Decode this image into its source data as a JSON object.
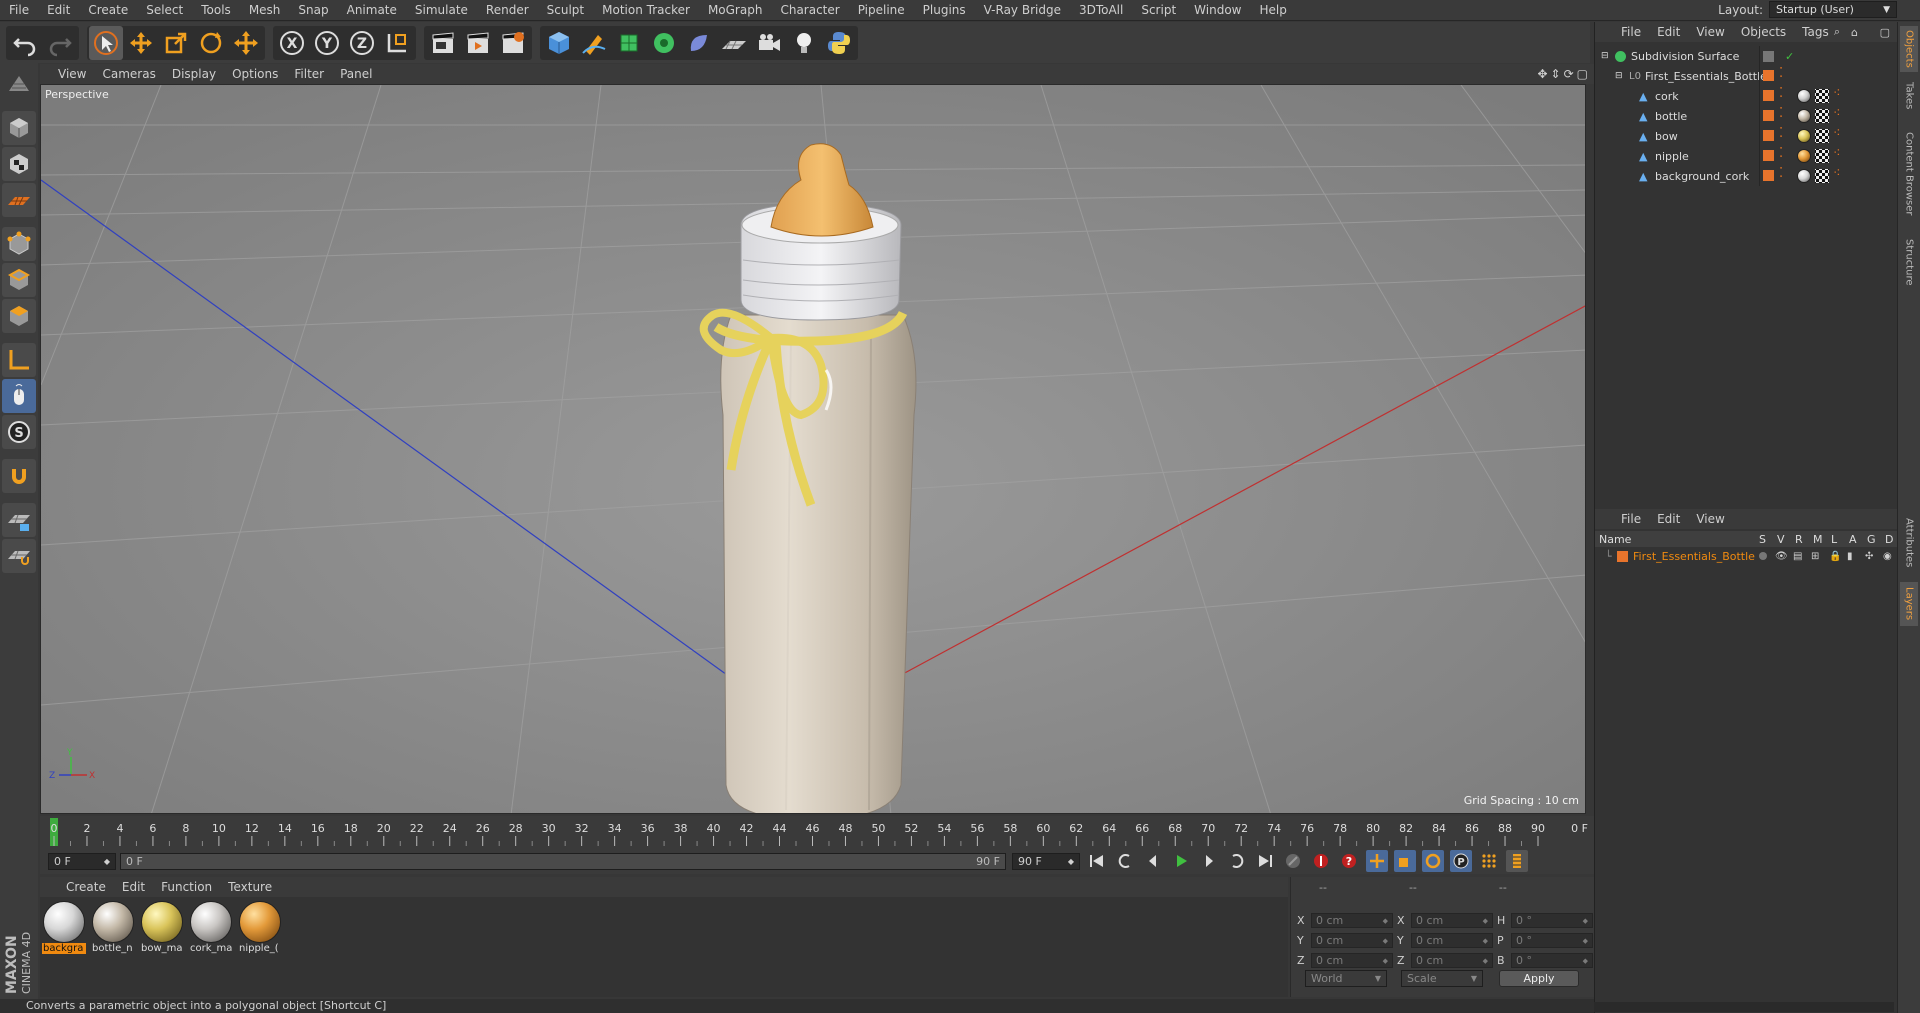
{
  "menu": [
    "File",
    "Edit",
    "Create",
    "Select",
    "Tools",
    "Mesh",
    "Snap",
    "Animate",
    "Simulate",
    "Render",
    "Sculpt",
    "Motion Tracker",
    "MoGraph",
    "Character",
    "Pipeline",
    "Plugins",
    "V-Ray Bridge",
    "3DToAll",
    "Script",
    "Window",
    "Help"
  ],
  "layout": {
    "label": "Layout:",
    "value": "Startup (User)"
  },
  "viewport": {
    "menu": [
      "View",
      "Cameras",
      "Display",
      "Options",
      "Filter",
      "Panel"
    ],
    "camera_label": "Perspective",
    "grid_spacing": "Grid Spacing : 10 cm"
  },
  "timeline": {
    "ticks": [
      "0",
      "2",
      "4",
      "6",
      "8",
      "10",
      "12",
      "14",
      "16",
      "18",
      "20",
      "22",
      "24",
      "26",
      "28",
      "30",
      "32",
      "34",
      "36",
      "38",
      "40",
      "42",
      "44",
      "46",
      "48",
      "50",
      "52",
      "54",
      "56",
      "58",
      "60",
      "62",
      "64",
      "66",
      "68",
      "70",
      "72",
      "74",
      "76",
      "78",
      "80",
      "82",
      "84",
      "86",
      "88",
      "90"
    ],
    "current_frame": "0 F",
    "right_frame": "0 F",
    "start_field": "0 F",
    "range_start": "0 F",
    "range_end": "90 F",
    "end_field": "90 F"
  },
  "materials": {
    "menu": [
      "Create",
      "Edit",
      "Function",
      "Texture"
    ],
    "items": [
      {
        "name": "backgra",
        "color": "#d7d7d7",
        "selected": true
      },
      {
        "name": "bottle_n",
        "color": "#c4b9a8",
        "selected": false
      },
      {
        "name": "bow_ma",
        "color": "#d9c45a",
        "selected": false
      },
      {
        "name": "cork_ma",
        "color": "#c9c6c3",
        "selected": false
      },
      {
        "name": "nipple_(",
        "color": "#e39a3a",
        "selected": false
      }
    ]
  },
  "coordinates": {
    "header": [
      "--",
      "--",
      "--"
    ],
    "rows": [
      {
        "a": "X",
        "av": "0 cm",
        "b": "X",
        "bv": "0 cm",
        "c": "H",
        "cv": "0 °"
      },
      {
        "a": "Y",
        "av": "0 cm",
        "b": "Y",
        "bv": "0 cm",
        "c": "P",
        "cv": "0 °"
      },
      {
        "a": "Z",
        "av": "0 cm",
        "b": "Z",
        "bv": "0 cm",
        "c": "B",
        "cv": "0 °"
      }
    ],
    "mode1": "World",
    "mode2": "Scale",
    "apply": "Apply"
  },
  "status": "Converts a parametric object into a polygonal object [Shortcut C]",
  "brand": {
    "maxon": "MAXON",
    "product": "CINEMA 4D"
  },
  "objects": {
    "menu": [
      "File",
      "Edit",
      "View",
      "Objects",
      "Tags"
    ],
    "tree": [
      {
        "name": "Subdivision Surface",
        "indent": 0,
        "tag": null
      },
      {
        "name": "First_Essentials_Bottle",
        "indent": 1,
        "tag": null
      },
      {
        "name": "cork",
        "indent": 2,
        "tag": "#cfcfcf"
      },
      {
        "name": "bottle",
        "indent": 2,
        "tag": "#c4b9a8"
      },
      {
        "name": "bow",
        "indent": 2,
        "tag": "#d9c45a"
      },
      {
        "name": "nipple",
        "indent": 2,
        "tag": "#e39a3a"
      },
      {
        "name": "background_cork",
        "indent": 2,
        "tag": "#d7d7d7"
      }
    ]
  },
  "layers": {
    "menu": [
      "File",
      "Edit",
      "View"
    ],
    "header": {
      "name": "Name",
      "cols": [
        "S",
        "V",
        "R",
        "M",
        "L",
        "A",
        "G",
        "D"
      ]
    },
    "items": [
      {
        "name": "First_Essentials_Bottle",
        "color": "#e8742c"
      }
    ]
  },
  "right_tabs": [
    "Objects",
    "Takes",
    "Content Browser",
    "Structure",
    "Attributes",
    "Layers"
  ],
  "colors": {
    "accent": "#f08a10",
    "x_axis": "#c03030",
    "z_axis": "#3040c0"
  }
}
